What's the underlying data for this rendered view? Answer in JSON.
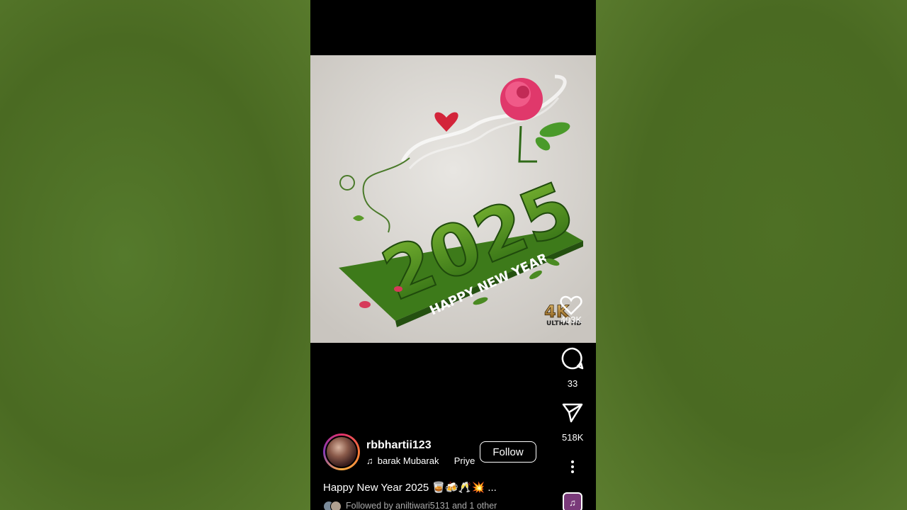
{
  "post": {
    "image_alt": "2025 Happy New Year grass art",
    "image_text_year": "2025",
    "image_text_greeting": "HAPPY NEW YEAR",
    "badge_top": "4K",
    "badge_bottom": "ULTRA HD"
  },
  "actions": {
    "likes": "403K",
    "comments": "33",
    "shares": "518K"
  },
  "author": {
    "username": "rbbhartii123",
    "song": "barak Mubarak",
    "artist": "Priye",
    "follow_label": "Follow"
  },
  "caption": "Happy New Year 2025 🥃🍻🥂💥 ...",
  "followed_by": "Followed by aniltiwari5131 and 1 other",
  "colors": {
    "accent_gradient": [
      "#e1306c",
      "#f77737",
      "#fcaf45",
      "#833ab4"
    ],
    "background": "#000000",
    "surround": "#4a6a22"
  }
}
